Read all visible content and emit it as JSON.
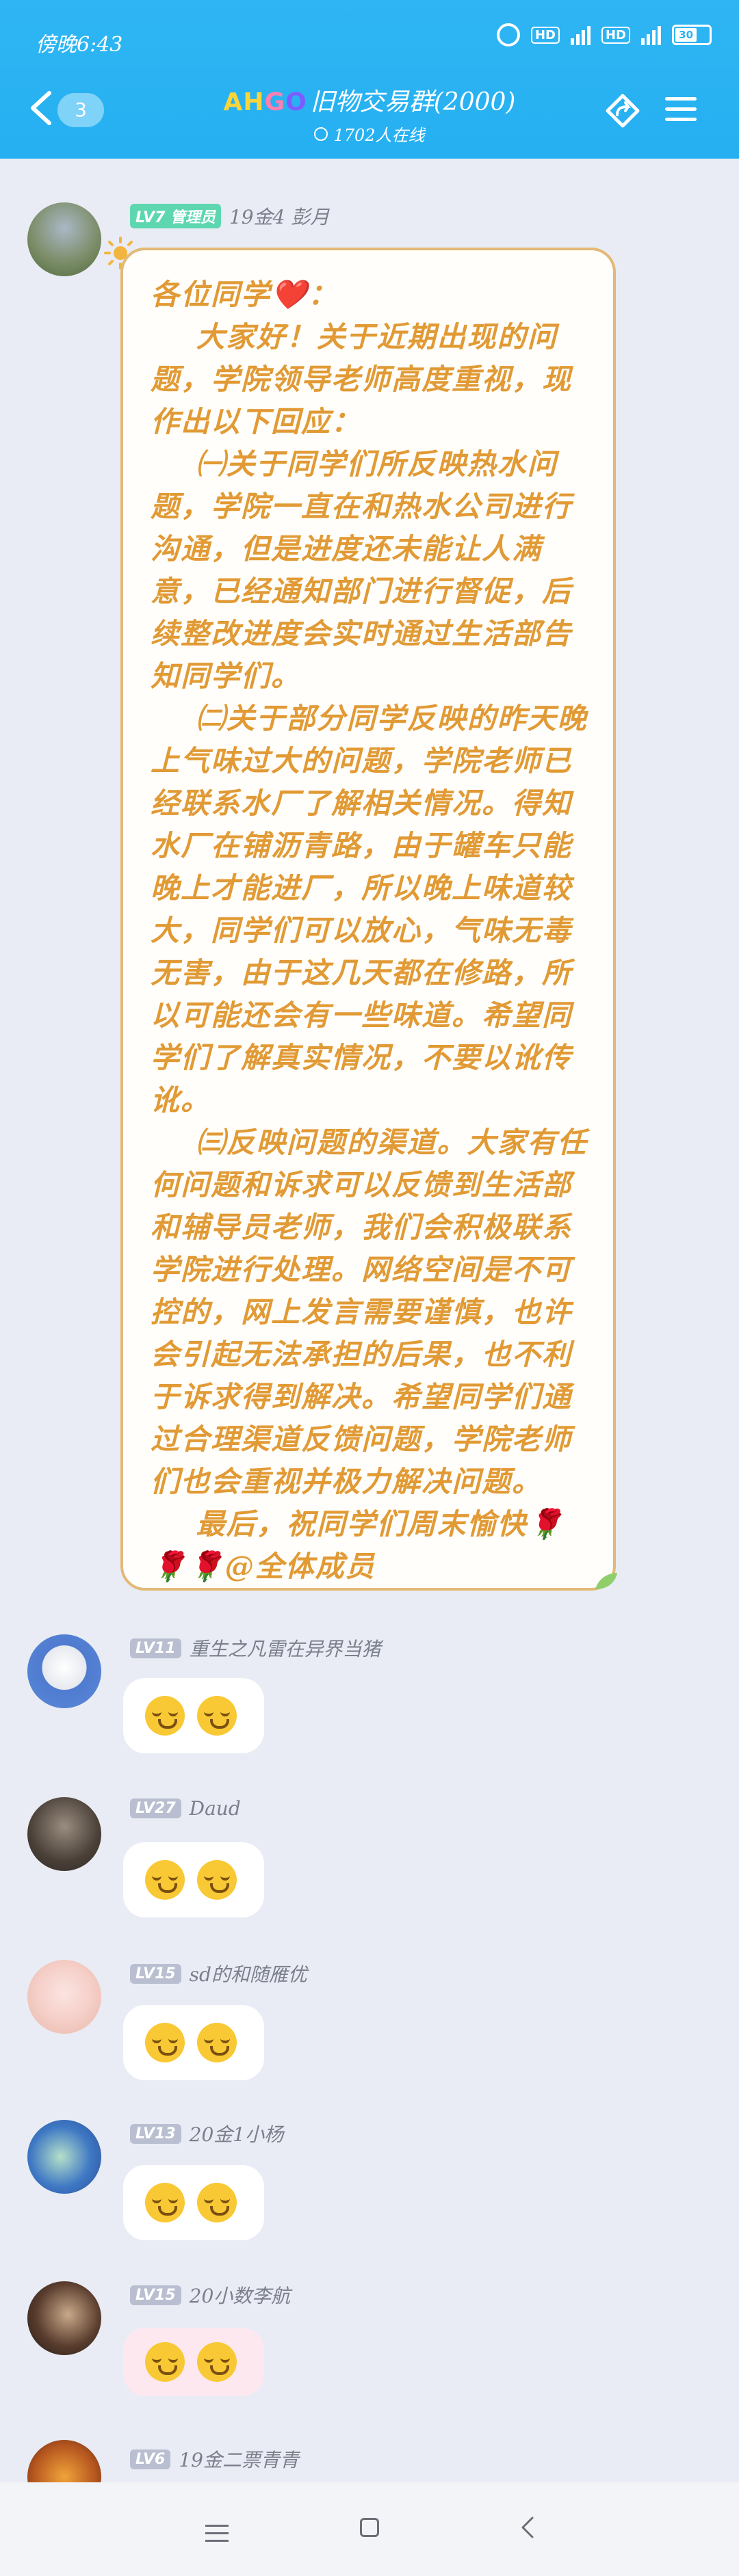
{
  "status_bar": {
    "time": "傍晚6:43",
    "hd1": "HD",
    "hd2": "HD",
    "battery": "30"
  },
  "header": {
    "unread_count": "3",
    "brand_part1": "AH",
    "brand_part2": "G",
    "brand_part3": "O",
    "group_name": "旧物交易群(2000)",
    "online": "1702人在线"
  },
  "notice_message": {
    "level": "LV7 管理员",
    "sender": "19金4 彭月",
    "paragraphs": [
      "各位同学❤️：",
      "    大家好！关于近期出现的问题，学院领导老师高度重视，现作出以下回应：",
      "    ㈠关于同学们所反映热水问题，学院一直在和热水公司进行沟通，但是进度还未能让人满意，已经通知部门进行督促，后续整改进度会实时通过生活部告知同学们。",
      "    ㈡关于部分同学反映的昨天晚上气味过大的问题，学院老师已经联系水厂了解相关情况。得知水厂在铺沥青路，由于罐车只能晚上才能进厂，所以晚上味道较大，同学们可以放心，气味无毒无害，由于这几天都在修路，所以可能还会有一些味道。希望同学们了解真实情况，不要以讹传讹。",
      "    ㈢反映问题的渠道。大家有任何问题和诉求可以反馈到生活部和辅导员老师，我们会积极联系学院进行处理。网络空间是不可控的，网上发言需要谨慎，也许会引起无法承担的后果，也不利于诉求得到解决。希望同学们通过合理渠道反馈问题，学院老师们也会重视并极力解决问题。",
      "    最后，祝同学们周末愉快🌹",
      "🌹🌹@全体成员"
    ]
  },
  "replies": [
    {
      "level": "LV11",
      "sender": "重生之凡雷在异界当猪",
      "content": "🤭🤭"
    },
    {
      "level": "LV27",
      "sender": "Daud",
      "content": "🤭🤭"
    },
    {
      "level": "LV15",
      "sender": "sd的和随雁优",
      "content": "🤭🤭"
    },
    {
      "level": "LV13",
      "sender": "20金1小杨",
      "content": "🤭🤭"
    },
    {
      "level": "LV15",
      "sender": "20小数李航",
      "content": "🤭🤭"
    },
    {
      "level": "LV6",
      "sender": "19金二票青青",
      "content": ""
    }
  ],
  "colors": {
    "header": "#2fb5f3",
    "notice_text": "#e19a35",
    "notice_border": "#e3b977",
    "background": "#e9ecf4"
  },
  "icons": {
    "share": "share-arrow-icon",
    "menu": "menu-icon",
    "back": "back-chevron-icon"
  }
}
